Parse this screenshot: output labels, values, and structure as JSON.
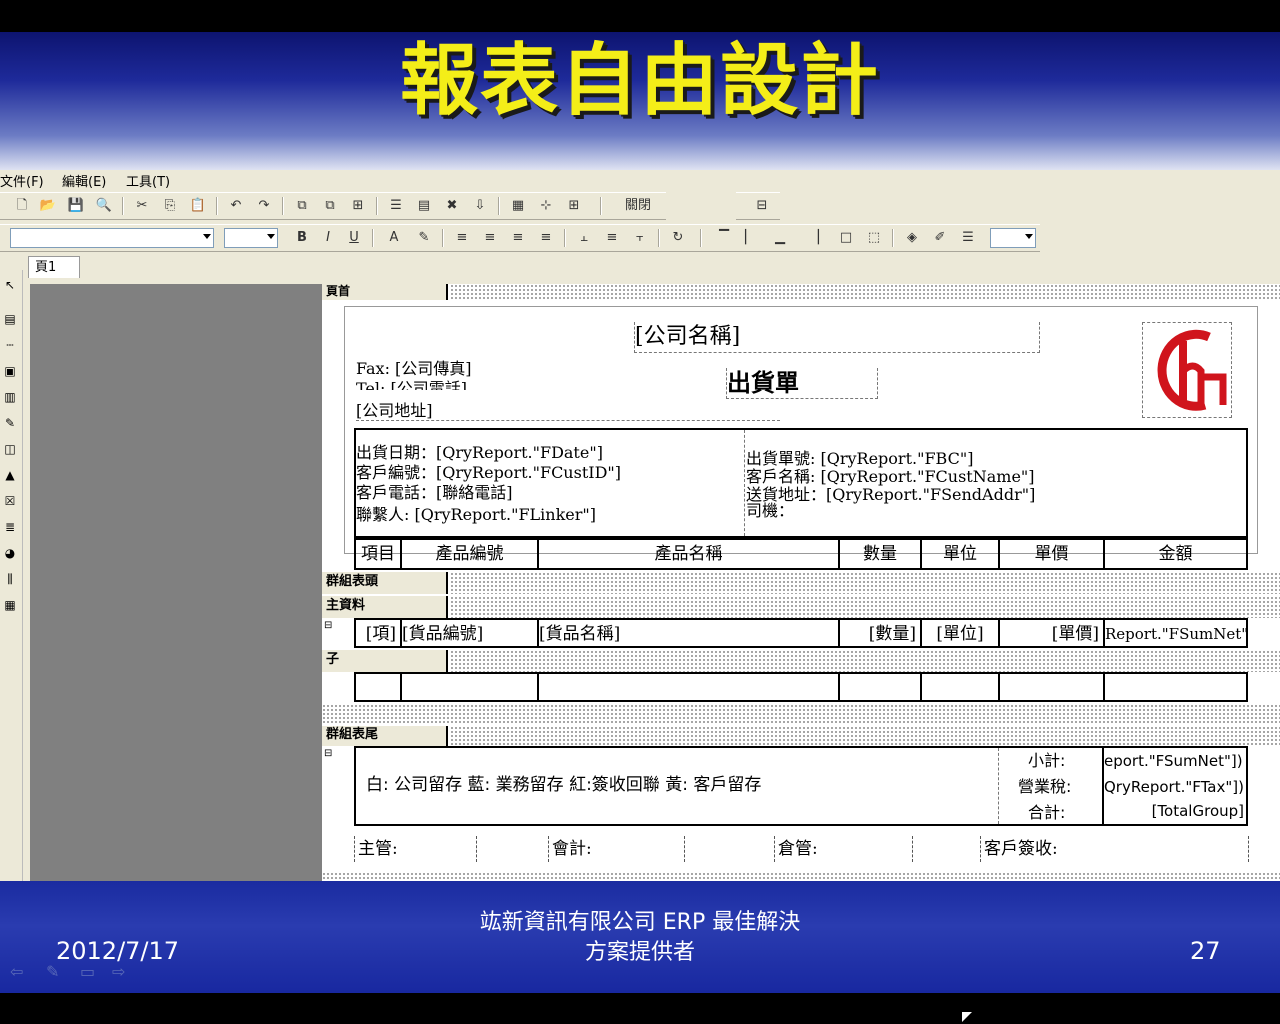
{
  "slide": {
    "title": "報表自由設計",
    "date": "2012/7/17",
    "company_line1": "竑新資訊有限公司  ERP 最佳解決",
    "company_line2": "方案提供者",
    "page_number": "27"
  },
  "menu": [
    "文件(F)",
    "編輯(E)",
    "工具(T)"
  ],
  "toolbar": {
    "close_label": "關閉"
  },
  "tabs": {
    "page1": "頁1"
  },
  "bands": {
    "header": "頁首",
    "group_header": "群組表頭",
    "master_data": "主資料",
    "child": "子",
    "group_footer": "群組表尾"
  },
  "report": {
    "company_name": "[公司名稱]",
    "fax": "Fax: [公司傳真]",
    "tel": "Tel: [公司電話]",
    "address": "[公司地址]",
    "doc_title": "出貨單",
    "left_fields": [
      "出貨日期：[QryReport.\"FDate\"]",
      "客戶編號：[QryReport.\"FCustID\"]",
      "客戶電話：[聯絡電話]",
      "聯繫人: [QryReport.\"FLinker\"]"
    ],
    "right_fields": [
      "出貨單號: [QryReport.\"FBC\"]",
      "客戶名稱:  [QryReport.\"FCustName\"]",
      "送貨地址：[QryReport.\"FSendAddr\"]",
      "司機："
    ],
    "columns": [
      "項目",
      "產品編號",
      "產品名稱",
      "數量",
      "單位",
      "單價",
      "金額"
    ],
    "data_row": [
      "[項]",
      "[貨品編號]",
      "[貨品名稱]",
      "[數量]",
      "[單位]",
      "[單價]",
      "Report.\"FSumNet\"]"
    ],
    "copies_note": "白: 公司留存     藍: 業務留存     紅:簽收回聯     黃: 客戶留存",
    "totals_labels": [
      "小計:",
      "營業稅:",
      "合計:"
    ],
    "totals_values": [
      "eport.\"FSumNet\"])]",
      "QryReport.\"FTax\"])]",
      "[TotalGroup]"
    ],
    "signatures": [
      "主管:",
      "會計:",
      "倉管:",
      "客戶簽收:"
    ]
  },
  "colors": {
    "title_yellow": "#f4ee18",
    "logo_red": "#d0141c",
    "footer_blue": "#1a2ba0"
  }
}
